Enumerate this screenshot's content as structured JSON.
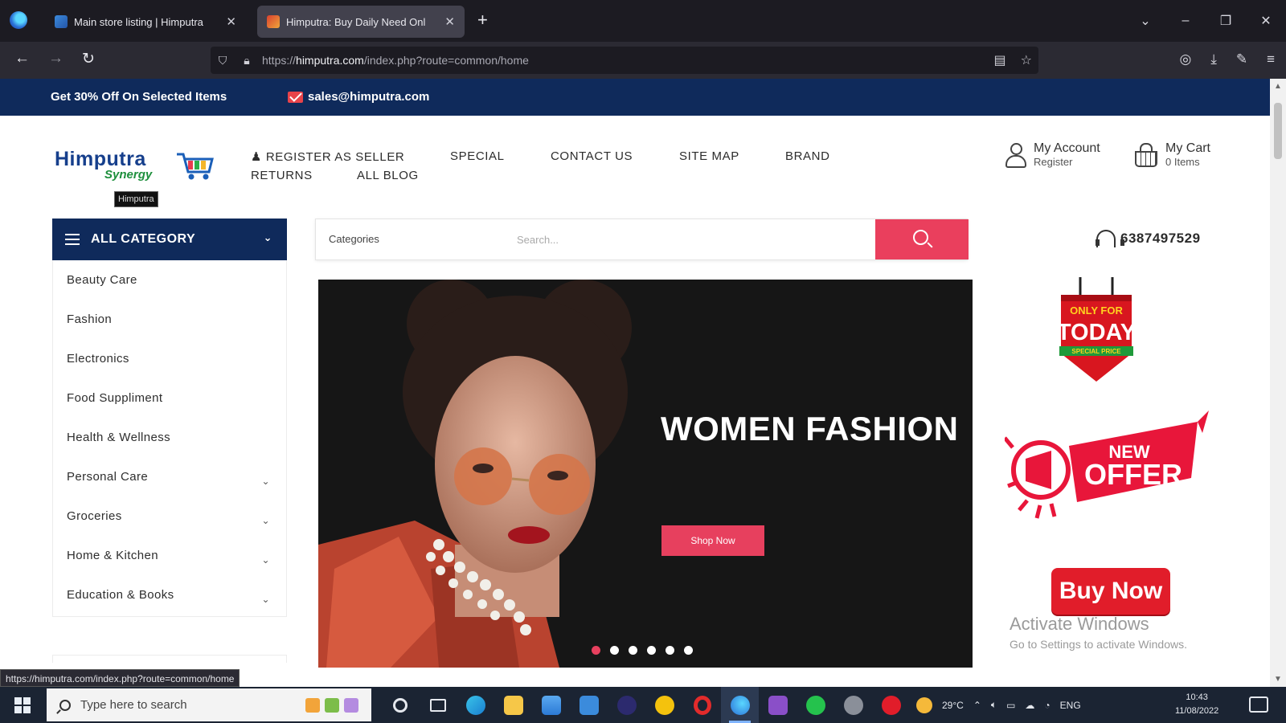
{
  "browser": {
    "tabs": [
      {
        "title": "Main store listing | Himputra"
      },
      {
        "title": "Himputra: Buy Daily Need Onl"
      }
    ],
    "url_prefix": "https://",
    "url_host": "himputra.com",
    "url_path": "/index.php?route=common/home",
    "status_url": "https://himputra.com/index.php?route=common/home"
  },
  "topbar": {
    "promo": "Get 30% Off On Selected Items",
    "email": "sales@himputra.com"
  },
  "header": {
    "logo_line1": "Himputra",
    "logo_line2": "Synergy",
    "logo_tooltip": "Himputra",
    "menu": {
      "register_seller": "REGISTER AS SELLER",
      "special": "SPECIAL",
      "contact": "CONTACT US",
      "sitemap": "SITE MAP",
      "brand": "BRAND",
      "returns": "RETURNS",
      "blog": "ALL BLOG"
    },
    "account_label": "My Account",
    "account_sub": "Register",
    "cart_label": "My Cart",
    "cart_sub": "0 Items"
  },
  "search": {
    "all_category": "ALL CATEGORY",
    "categories_label": "Categories",
    "placeholder": "Search...",
    "phone": "6387497529"
  },
  "categories": [
    {
      "label": "Beauty Care",
      "has_sub": false
    },
    {
      "label": "Fashion",
      "has_sub": false
    },
    {
      "label": "Electronics",
      "has_sub": false
    },
    {
      "label": "Food Suppliment",
      "has_sub": false
    },
    {
      "label": "Health & Wellness",
      "has_sub": false
    },
    {
      "label": "Personal Care",
      "has_sub": true
    },
    {
      "label": "Groceries",
      "has_sub": true
    },
    {
      "label": "Home & Kitchen",
      "has_sub": true
    },
    {
      "label": "Education & Books",
      "has_sub": true
    }
  ],
  "banner": {
    "title": "WOMEN FASHION",
    "button": "Shop Now",
    "slide_count": 6,
    "active_slide": 1
  },
  "side_promo": {
    "badge_top": "ONLY FOR",
    "badge_main": "TODAY",
    "badge_bottom": "SPECIAL PRICE",
    "offer_top": "NEW",
    "offer_main": "OFFER",
    "buy_now": "Buy Now"
  },
  "watermark": {
    "line1": "Activate Windows",
    "line2": "Go to Settings to activate Windows."
  },
  "taskbar": {
    "search_placeholder": "Type here to search",
    "temperature": "29°C",
    "language": "ENG",
    "time": "10:43",
    "date": "11/08/2022"
  },
  "colors": {
    "navy": "#0f2a5b",
    "accent": "#ea3f5d",
    "buy_now_red": "#e11d2a"
  }
}
